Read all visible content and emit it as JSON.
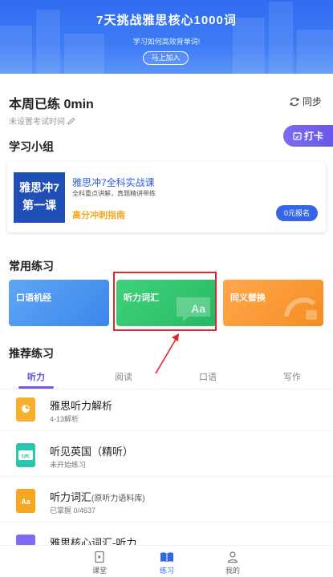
{
  "banner": {
    "title": "7天挑战雅思核心1000词",
    "subtitle": "学习如何高效背单词!",
    "join_button": "马上加入"
  },
  "stats": {
    "week_practice": "本周已练 0min",
    "sync_label": "同步",
    "exam_time": "未设置考试时间",
    "punch_label": "打卡"
  },
  "study_group": {
    "title": "学习小组",
    "card": {
      "cover_text": "雅思冲7\n第一课",
      "cover_line1": "雅思冲7",
      "cover_line2": "第一课",
      "course_title": "雅思冲7全科实战课",
      "course_sub": "全科重点讲解，真题精讲带练",
      "tag": "高分冲刺指南",
      "enroll_button": "0元报名"
    }
  },
  "common_practice": {
    "title": "常用练习",
    "cards": [
      {
        "label": "口语机经",
        "color": "#4a94f0"
      },
      {
        "label": "听力词汇",
        "color": "#33c672"
      },
      {
        "label": "同义替换",
        "color": "#fa9a36"
      }
    ],
    "card_glyph": "Aa"
  },
  "recommended": {
    "title": "推荐练习",
    "tabs": [
      "听力",
      "阅读",
      "口语",
      "写作"
    ],
    "active_tab": "听力",
    "items": [
      {
        "title": "雅思听力解析",
        "note": "",
        "sub": "4-13解析",
        "icon": "headphone-book-icon",
        "color": "#f5b12e"
      },
      {
        "title": "听见英国（精听）",
        "note": "",
        "sub": "未开始练习",
        "icon": "uk-book-icon",
        "color": "#2ec5b0"
      },
      {
        "title": "听力词汇",
        "note": "(原听力语料库)",
        "sub": "已掌握 0/4637",
        "icon": "aa-book-icon",
        "color": "#f5a623"
      },
      {
        "title": "雅思核心词汇-听力",
        "note": "",
        "sub": "",
        "icon": "folder-icon",
        "color": "#7b6cf0"
      }
    ]
  },
  "bottom_nav": [
    {
      "label": "课堂",
      "icon": "classroom-icon"
    },
    {
      "label": "练习",
      "icon": "practice-book-icon",
      "active": true
    },
    {
      "label": "我的",
      "icon": "profile-icon"
    }
  ],
  "colors": {
    "primary": "#3566e6",
    "accent_purple": "#6a5cf0",
    "highlight_box": "#e3242b"
  }
}
